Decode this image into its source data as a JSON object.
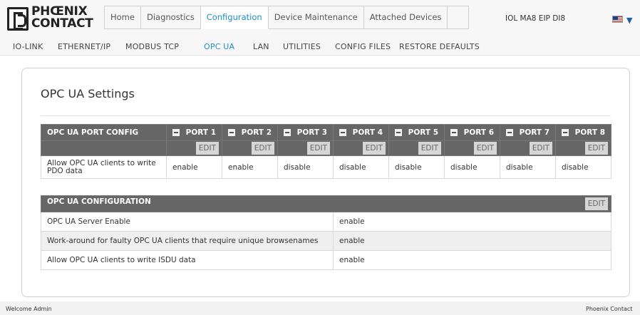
{
  "brand": {
    "logo_line1": "PHŒNIX",
    "logo_line2": "CONTACT"
  },
  "tabs": [
    {
      "label": "Home",
      "active": false
    },
    {
      "label": "Diagnostics",
      "active": false
    },
    {
      "label": "Configuration",
      "active": true
    },
    {
      "label": "Device Maintenance",
      "active": false
    },
    {
      "label": "Attached Devices",
      "active": false
    }
  ],
  "device_name": "IOL MA8 EIP DI8",
  "language": {
    "icon": "us-flag-icon",
    "dropdown_icon": "triangle-down-icon"
  },
  "subnav": [
    {
      "label": "IO-LINK",
      "active": false
    },
    {
      "label": "ETHERNET/IP",
      "active": false
    },
    {
      "label": "MODBUS TCP",
      "active": false
    },
    {
      "label": "OPC UA",
      "active": true
    },
    {
      "label": "LAN",
      "active": false
    },
    {
      "label": "UTILITIES",
      "active": false
    },
    {
      "label": "CONFIG FILES",
      "active": false
    },
    {
      "label": "RESTORE DEFAULTS",
      "active": false
    }
  ],
  "page": {
    "title": "OPC UA Settings",
    "port_config": {
      "header": "OPC UA PORT CONFIG",
      "edit_label": "EDIT",
      "ports": [
        "PORT 1",
        "PORT 2",
        "PORT 3",
        "PORT 4",
        "PORT 5",
        "PORT 6",
        "PORT 7",
        "PORT 8"
      ],
      "rows": [
        {
          "label": "Allow OPC UA clients to write PDO data",
          "values": [
            "enable",
            "enable",
            "disable",
            "disable",
            "disable",
            "disable",
            "disable",
            "disable"
          ]
        }
      ]
    },
    "configuration": {
      "header": "OPC UA CONFIGURATION",
      "edit_label": "EDIT",
      "rows": [
        {
          "label": "OPC UA Server Enable",
          "value": "enable"
        },
        {
          "label": "Work-around for faulty OPC UA clients that require unique browsenames",
          "value": "enable"
        },
        {
          "label": "Allow OPC UA clients to write ISDU data",
          "value": "enable"
        }
      ]
    }
  },
  "footer": {
    "left": "Welcome Admin",
    "right": "Phoenix Contact"
  },
  "colors": {
    "accent": "#1f8ec9",
    "table_header": "#666666",
    "edit_button": "#d6d6d6"
  }
}
